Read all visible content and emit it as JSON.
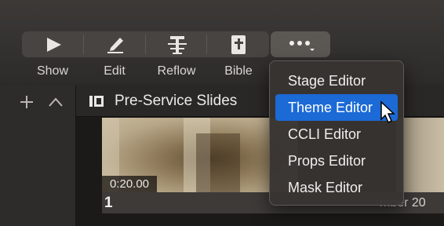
{
  "toolbar": {
    "buttons": [
      {
        "label": "Show",
        "icon": "play-icon"
      },
      {
        "label": "Edit",
        "icon": "pencil-icon"
      },
      {
        "label": "Reflow",
        "icon": "reflow-icon"
      },
      {
        "label": "Bible",
        "icon": "bible-icon"
      }
    ],
    "more_icon": "ellipsis-icon"
  },
  "sidebar": {
    "add_icon": "plus-icon",
    "collapse_icon": "chevron-up-icon"
  },
  "playlist": {
    "title": "Pre-Service Slides",
    "icon": "playlist-icon"
  },
  "slide": {
    "timecode": "0:20.00",
    "number": "1",
    "caption": "mber 20"
  },
  "menu": {
    "items": [
      {
        "label": "Stage Editor"
      },
      {
        "label": "Theme Editor"
      },
      {
        "label": "CCLI Editor"
      },
      {
        "label": "Props Editor"
      },
      {
        "label": "Mask Editor"
      }
    ],
    "selected_index": 1
  },
  "colors": {
    "selection": "#1b6ad6",
    "background": "#1f1e1d"
  }
}
